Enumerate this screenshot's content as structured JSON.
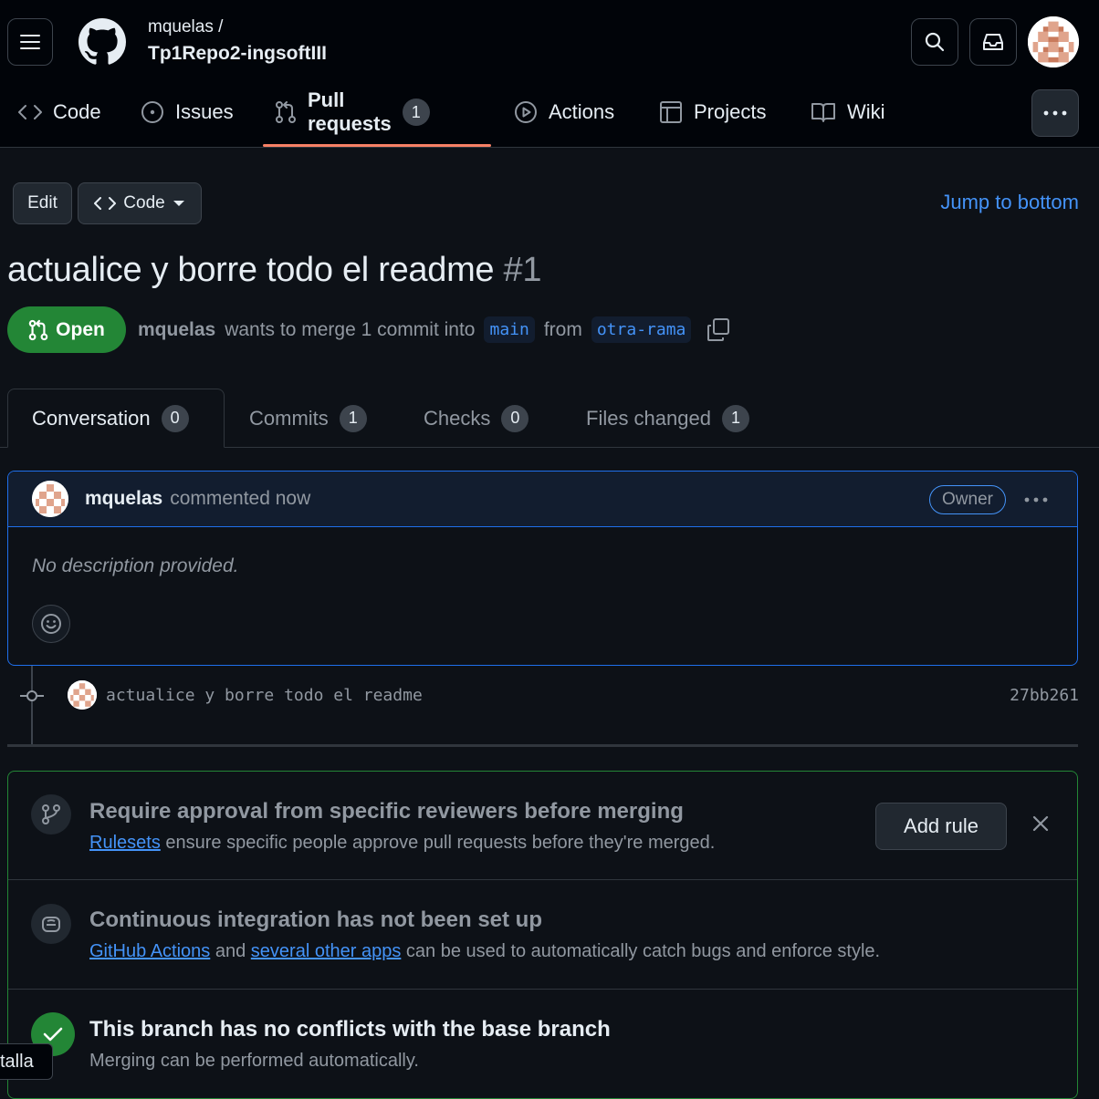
{
  "header": {
    "owner": "mquelas /",
    "repo": "Tp1Repo2-ingsoftIII"
  },
  "repo_tabs": [
    {
      "label": "Code",
      "icon": "code-icon"
    },
    {
      "label": "Issues",
      "icon": "issue-icon"
    },
    {
      "label": "Pull requests",
      "icon": "pull-request-icon",
      "count": "1",
      "active": true
    },
    {
      "label": "Actions",
      "icon": "play-icon"
    },
    {
      "label": "Projects",
      "icon": "table-icon"
    },
    {
      "label": "Wiki",
      "icon": "book-icon"
    }
  ],
  "toolbar": {
    "edit_label": "Edit",
    "code_label": "Code",
    "jump_label": "Jump to bottom"
  },
  "pr": {
    "title": "actualice y borre todo el readme",
    "number": "#1",
    "state": "Open",
    "author": "mquelas",
    "merge_text": "wants to merge 1 commit into",
    "base_branch": "main",
    "from_text": "from",
    "head_branch": "otra-rama"
  },
  "pr_tabs": [
    {
      "label": "Conversation",
      "count": "0"
    },
    {
      "label": "Commits",
      "count": "1"
    },
    {
      "label": "Checks",
      "count": "0"
    },
    {
      "label": "Files changed",
      "count": "1"
    }
  ],
  "comment": {
    "author": "mquelas",
    "when": "commented now",
    "badge": "Owner",
    "body": "No description provided."
  },
  "commit": {
    "message": "actualice y borre todo el readme",
    "sha": "27bb261"
  },
  "merge_box": {
    "rule_title": "Require approval from specific reviewers before merging",
    "rule_link": "Rulesets",
    "rule_text": "ensure specific people approve pull requests before they're merged.",
    "add_rule_label": "Add rule",
    "ci_title": "Continuous integration has not been set up",
    "ci_link1": "GitHub Actions",
    "ci_and": "and",
    "ci_link2": "several other apps",
    "ci_text": "can be used to automatically catch bugs and enforce style.",
    "conflict_title": "This branch has no conflicts with the base branch",
    "conflict_text": "Merging can be performed automatically."
  },
  "tooltip": "talla",
  "colors": {
    "background": "#0d1117",
    "accent_blue": "#4493f8",
    "open_green": "#238636",
    "tab_underline": "#f78166"
  }
}
